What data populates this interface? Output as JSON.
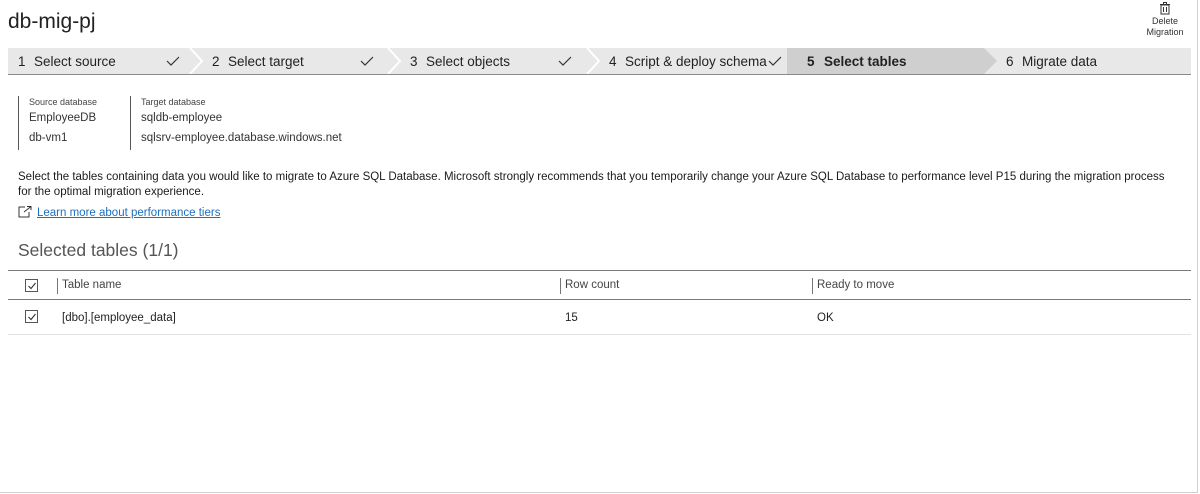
{
  "header": {
    "title": "db-mig-pj",
    "delete_label_line1": "Delete",
    "delete_label_line2": "Migration"
  },
  "wizard": {
    "steps": [
      {
        "number": "1",
        "label": "Select source",
        "completed": true
      },
      {
        "number": "2",
        "label": "Select target",
        "completed": true
      },
      {
        "number": "3",
        "label": "Select objects",
        "completed": true
      },
      {
        "number": "4",
        "label": "Script & deploy schema",
        "completed": true
      },
      {
        "number": "5",
        "label": "Select tables",
        "completed": false,
        "active": true
      },
      {
        "number": "6",
        "label": "Migrate data",
        "completed": false
      }
    ]
  },
  "source": {
    "caption": "Source database",
    "database": "EmployeeDB",
    "server": "db-vm1"
  },
  "target": {
    "caption": "Target database",
    "database": "sqldb-employee",
    "server": "sqlsrv-employee.database.windows.net"
  },
  "description": "Select the tables containing data you would like to migrate to Azure SQL Database. Microsoft strongly recommends that you temporarily change your Azure SQL Database to performance level P15 during the migration process for the optimal migration experience.",
  "learn_more": "Learn more about performance tiers",
  "section_title": "Selected tables (1/1)",
  "table": {
    "columns": [
      "Table name",
      "Row count",
      "Ready to move"
    ],
    "select_all_checked": true,
    "rows": [
      {
        "checked": true,
        "table_name": "[dbo].[employee_data]",
        "row_count": "15",
        "ready": "OK"
      }
    ]
  },
  "colors": {
    "link": "#1a6fc2",
    "wizard_bg": "#e8e8e8",
    "wizard_active_bg": "#cfcfcf"
  },
  "icons": {
    "delete": "trash-icon",
    "step_done": "checkmark-icon",
    "external_link": "external-link-icon",
    "checkbox": "checkbox-checked-icon"
  }
}
